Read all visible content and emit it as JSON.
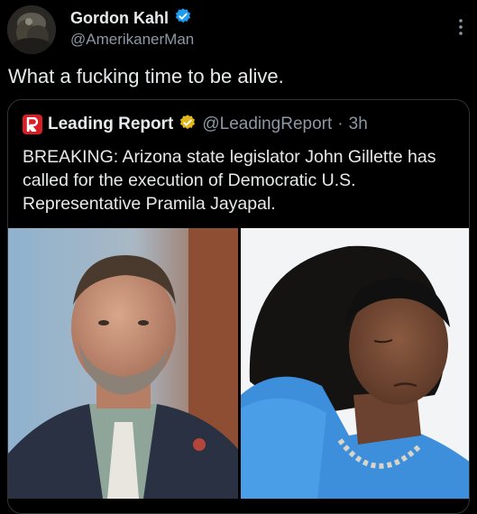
{
  "author": {
    "display_name": "Gordon Kahl",
    "handle": "@AmerikanerMan",
    "verified_icon": "verified-badge-icon",
    "verified_color": "#1d9bf0"
  },
  "tweet": {
    "text": "What a fucking time to be alive."
  },
  "quoted": {
    "display_name": "Leading Report",
    "logo_letter": "R",
    "logo_color": "#d81f26",
    "verified_icon": "gold-verified-badge-icon",
    "verified_color": "#e2b719",
    "handle": "@LeadingReport",
    "separator": "·",
    "time": "3h",
    "text": "BREAKING: Arizona state legislator John Gillette has called for the execution of Democratic U.S. Representative Pramila Jayapal.",
    "images": [
      {
        "name": "photo-man-in-suit"
      },
      {
        "name": "photo-woman-in-blue-jacket"
      }
    ]
  },
  "colors": {
    "background": "#000000",
    "text_primary": "#e7e9ea",
    "text_secondary": "#8b98a5",
    "border": "#2f3336"
  }
}
